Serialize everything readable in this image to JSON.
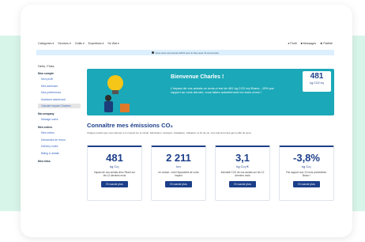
{
  "nav": {
    "left": [
      "Catégories ▾",
      "Services ▾",
      "Outils ▾",
      "Expertises ▾",
      "Se Wat ▾"
    ],
    "right": [
      {
        "icon": "user-icon",
        "label": "Profil"
      },
      {
        "icon": "building-icon",
        "label": "Messages"
      },
      {
        "icon": "star-icon",
        "label": "Fidélité"
      }
    ]
  },
  "banner": {
    "text": "Vous avez économisé 420 € pour le bien avec IA économisé."
  },
  "sidebar": {
    "hello": "Hello, Frida",
    "sections": [
      {
        "title": "Mon compte",
        "links": [
          "Mon profil",
          "Mes adresses",
          "Mes préférences",
          "Assistant dashboard",
          "Calculer Impact Charbon"
        ]
      },
      {
        "title": "Ma company",
        "links": [
          "Manage users"
        ]
      },
      {
        "title": "Mes orders",
        "links": [
          "Mes orders",
          "Demandes de retour",
          "Delivery notes",
          "Billing & details"
        ]
      },
      {
        "title": "Mes infos",
        "links": []
      }
    ]
  },
  "hero": {
    "title": "Bienvenue Charles !",
    "text": "L'impact de vos achats ce mois-ci est de 481 kg CO2 eq! Bravo, -15% par rapport au mois dernier, vous faites actuellement les bons choix !",
    "badge_value": "481",
    "badge_unit": "kg CO2 eq",
    "illustration": "lightbulb-person-icon"
  },
  "section": {
    "title": "Connaître mes émissions CO₂",
    "intro": "Chaque produit que vous achetez a un impact sur le climat. Fabrication, transport, installation, utilisation ou fin de vie, tout cela émet des gaz à effet de serre."
  },
  "cards": [
    {
      "value": "481",
      "unit": "kg Co₂",
      "desc": "Impact de vos achats chez Rexel sur les 12 derniers mois",
      "button": "En savoir plus"
    },
    {
      "value": "2 211",
      "unit": "km",
      "desc": "en voiture, c'est l'équivalent de votre impact",
      "button": "En savoir plus"
    },
    {
      "value": "3,1",
      "unit": "kg Co₂/€",
      "desc": "Intensité CO2 de vos achats sur les 12 derniers mois",
      "button": "En savoir plus"
    },
    {
      "value": "-3,8%",
      "unit": "kg Co₂",
      "desc": "Par rapport aux 12 mois précédents. Bravo !",
      "button": "En savoir plus"
    }
  ]
}
